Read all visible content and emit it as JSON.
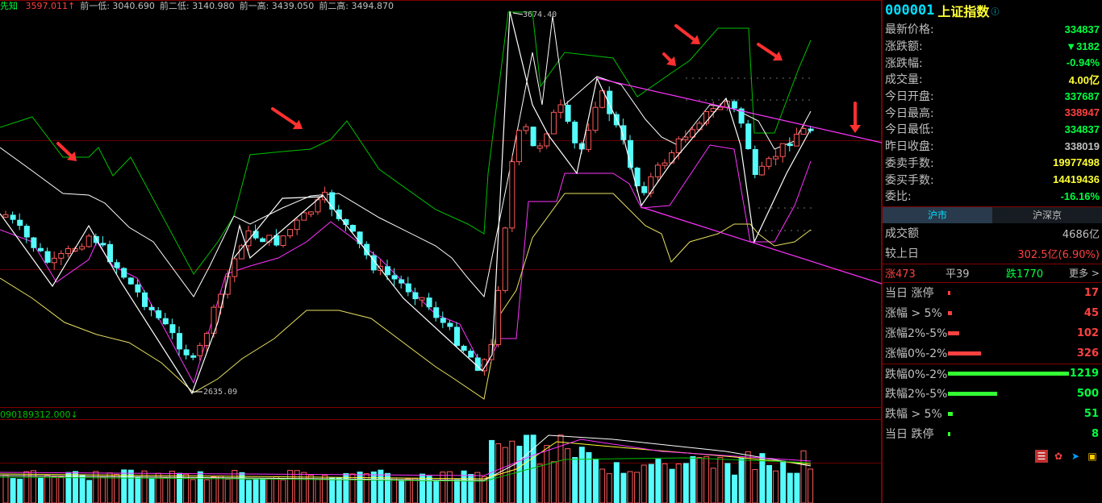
{
  "header": {
    "indicator_label": "先知",
    "items": [
      {
        "text": "3597.011↑",
        "color": "#ff4040"
      },
      {
        "text": "前一低: 3040.690",
        "color": "#c0c0c0"
      },
      {
        "text": "前二低: 3140.980",
        "color": "#c0c0c0"
      },
      {
        "text": "前一高: 3439.050",
        "color": "#c0c0c0"
      },
      {
        "text": "前二高: 3494.870",
        "color": "#c0c0c0"
      }
    ]
  },
  "chart_annotations": {
    "peak_label": "3674.40",
    "trough_label": "2635.09"
  },
  "volume_header": "090189312.000↓",
  "stock": {
    "code": "000001",
    "name": "上证指数",
    "info_icon": "info-circle-icon"
  },
  "quote_rows": [
    {
      "label": "最新价格:",
      "value": "334837",
      "color": "#00ff40"
    },
    {
      "label": "涨跌额:",
      "value": "▼3182",
      "color": "#00ff40"
    },
    {
      "label": "涨跌幅:",
      "value": "-0.94%",
      "color": "#00ff40"
    },
    {
      "label": "成交量:",
      "value": "4.00亿",
      "color": "#ffff33"
    },
    {
      "label": "今日开盘:",
      "value": "337687",
      "color": "#00ff40"
    },
    {
      "label": "今日最高:",
      "value": "338947",
      "color": "#ff4040"
    },
    {
      "label": "今日最低:",
      "value": "334837",
      "color": "#00ff40"
    },
    {
      "label": "昨日收盘:",
      "value": "338019",
      "color": "#c0c0c0"
    },
    {
      "label": "委卖手数:",
      "value": "19977498",
      "color": "#ffff33"
    },
    {
      "label": "委买手数:",
      "value": "14419436",
      "color": "#ffff33"
    },
    {
      "label": "委比:",
      "value": "-16.16%",
      "color": "#00ff40"
    }
  ],
  "tabs": [
    {
      "label": "沪市",
      "active": true
    },
    {
      "label": "沪深京",
      "active": false
    }
  ],
  "market": {
    "turnover_label": "成交额",
    "turnover_value": "4686亿",
    "change_label": "较上日",
    "change_value": "302.5亿(6.90%)"
  },
  "breadth": {
    "up": "涨473",
    "flat": "平39",
    "down": "跌1770",
    "more": "更多 >"
  },
  "distribution": [
    {
      "label": "当日 涨停",
      "count": "17",
      "bar": 0.01,
      "color": "#ff4040"
    },
    {
      "label": "涨幅 > 5%",
      "count": "45",
      "bar": 0.03,
      "color": "#ff4040"
    },
    {
      "label": "涨幅2%-5%",
      "count": "102",
      "bar": 0.09,
      "color": "#ff4040"
    },
    {
      "label": "涨幅0%-2%",
      "count": "326",
      "bar": 0.27,
      "color": "#ff4040"
    },
    {
      "label": "跌幅0%-2%",
      "count": "1219",
      "bar": 1.0,
      "color": "#33ff33"
    },
    {
      "label": "跌幅2%-5%",
      "count": "500",
      "bar": 0.41,
      "color": "#33ff33"
    },
    {
      "label": "跌幅 > 5%",
      "count": "51",
      "bar": 0.04,
      "color": "#33ff33"
    },
    {
      "label": "当日 跌停",
      "count": "8",
      "bar": 0.0,
      "color": "#33ff33"
    }
  ],
  "toolbar": [
    "report-icon",
    "fire-icon",
    "send-icon",
    "book-icon"
  ],
  "colors": {
    "up": "#ff4040",
    "down": "#00ff40",
    "accent": "#00e0ff",
    "highlight": "#ffff33",
    "grid": "#800000"
  }
}
